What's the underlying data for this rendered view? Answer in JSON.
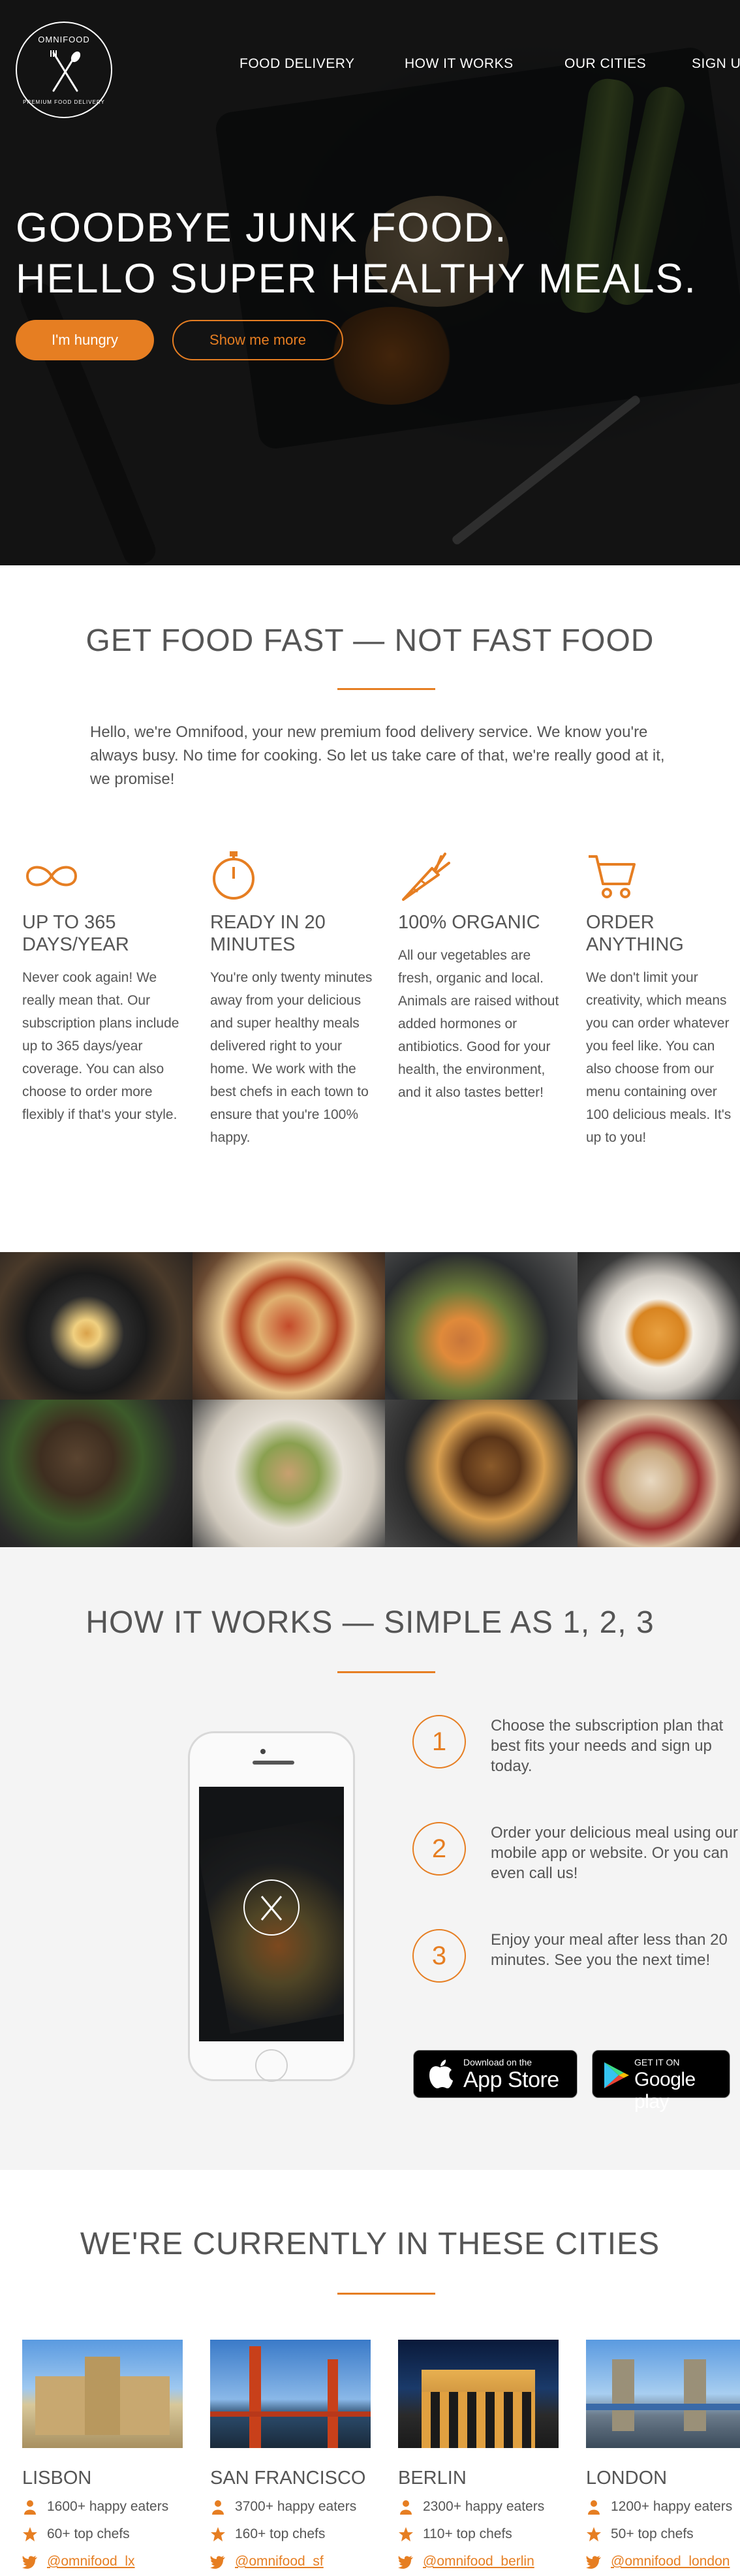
{
  "brand": {
    "logo_top": "OMNIFOOD",
    "logo_bottom": "PREMIUM FOOD DELIVERY",
    "accent": "#e67e22"
  },
  "nav": {
    "items": [
      "FOOD DELIVERY",
      "HOW IT WORKS",
      "OUR CITIES",
      "SIGN UP"
    ]
  },
  "hero": {
    "title_line1": "GOODBYE JUNK FOOD.",
    "title_line2": "HELLO SUPER HEALTHY MEALS.",
    "primary_button": "I'm hungry",
    "secondary_button": "Show me more"
  },
  "features_section": {
    "heading": "GET FOOD FAST — NOT FAST FOOD",
    "intro": "Hello, we're Omnifood, your new premium food delivery service. We know you're always busy. No time for cooking. So let us take care of that, we're really good at it, we promise!",
    "items": [
      {
        "icon": "infinity-icon",
        "title": "Up to 365 days/year",
        "text": "Never cook again! We really mean that. Our subscription plans include up to 365 days/year coverage. You can also choose to order more flexibly if that's your style."
      },
      {
        "icon": "stopwatch-icon",
        "title": "Ready in 20 minutes",
        "text": "You're only twenty minutes away from your delicious and super healthy meals delivered right to your home. We work with the best chefs in each town to ensure that you're 100% happy."
      },
      {
        "icon": "carrot-icon",
        "title": "100% organic",
        "text": "All our vegetables are fresh, organic and local. Animals are raised without added hormones or antibiotics. Good for your health, the environment, and it also tastes better!"
      },
      {
        "icon": "cart-icon",
        "title": "Order anything",
        "text": "We don't limit your creativity, which means you can order whatever you feel like. You can also choose from our menu containing over 100 delicious meals. It's up to you!"
      }
    ]
  },
  "gallery": {
    "photos": [
      "bibimbap-photo",
      "pizza-photo",
      "asparagus-chicken-photo",
      "soup-photo",
      "steak-asparagus-photo",
      "sandwich-photo",
      "burger-photo",
      "granola-berries-photo"
    ]
  },
  "how_section": {
    "heading": "HOW IT WORKS — SIMPLE AS 1, 2, 3",
    "steps": [
      {
        "number": "1",
        "text": "Choose the subscription plan that best fits your needs and sign up today."
      },
      {
        "number": "2",
        "text": "Order your delicious meal using our mobile app or website. Or you can even call us!"
      },
      {
        "number": "3",
        "text": "Enjoy your meal after less than 20 minutes. See you the next time!"
      }
    ],
    "app_store": {
      "small": "Download on the",
      "big": "App Store"
    },
    "google_play": {
      "small": "GET IT ON",
      "big": "Google play"
    }
  },
  "cities_section": {
    "heading": "WE'RE CURRENTLY IN THESE CITIES",
    "cities": [
      {
        "name": "Lisbon",
        "eaters": "1600+ happy eaters",
        "chefs": "60+ top chefs",
        "twitter": "@omnifood_lx"
      },
      {
        "name": "San Francisco",
        "eaters": "3700+ happy eaters",
        "chefs": "160+ top chefs",
        "twitter": "@omnifood_sf"
      },
      {
        "name": "Berlin",
        "eaters": "2300+ happy eaters",
        "chefs": "110+ top chefs",
        "twitter": "@omnifood_berlin"
      },
      {
        "name": "London",
        "eaters": "1200+ happy eaters",
        "chefs": "50+ top chefs",
        "twitter": "@omnifood_london"
      }
    ]
  }
}
